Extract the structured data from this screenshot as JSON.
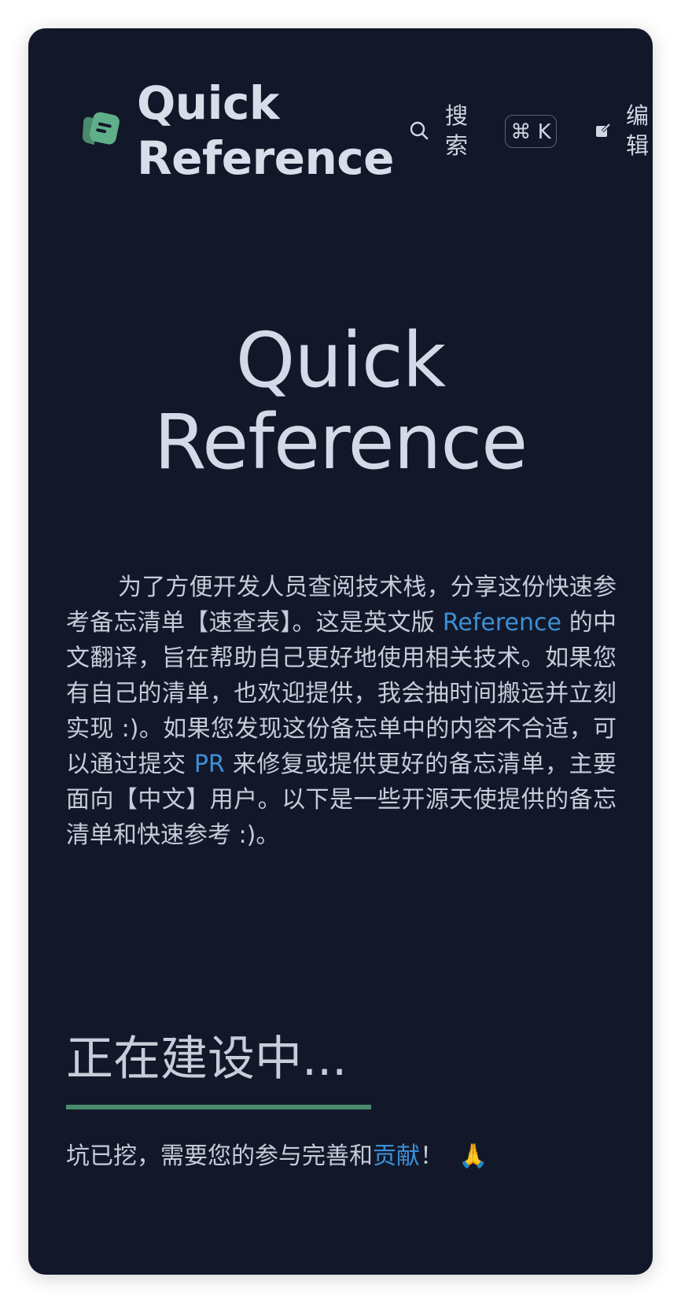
{
  "header": {
    "brand_line1": "Quick",
    "brand_line2": "Reference",
    "search_label": "搜索",
    "search_shortcut": "⌘ K",
    "edit_label": "编辑"
  },
  "hero": {
    "title_line1": "Quick",
    "title_line2": "Reference"
  },
  "intro": {
    "part1": "为了方便开发人员查阅技术栈，分享这份快速参考备忘清单【速查表】。这是英文版 ",
    "link_reference": "Reference",
    "part2": " 的中文翻译，旨在帮助自己更好地使用相关技术。如果您有自己的清单，也欢迎提供，我会抽时间搬运并立刻实现 :)。如果您发现这份备忘单中的内容不合适，可以通过提交 ",
    "link_pr": "PR",
    "part3": " 来修复或提供更好的备忘清单，主要面向【中文】用户。以下是一些开源天使提供的备忘清单和快速参考 :)。"
  },
  "section": {
    "title": "正在建设中...",
    "cta_text": "坑已挖，需要您的参与完善和",
    "cta_link": "贡献",
    "cta_suffix": "！",
    "cta_emoji": "🙏"
  },
  "colors": {
    "background": "#121829",
    "link": "#3d8fd6",
    "accent_green": "#4a8a6d",
    "text": "#c6ccd8"
  }
}
